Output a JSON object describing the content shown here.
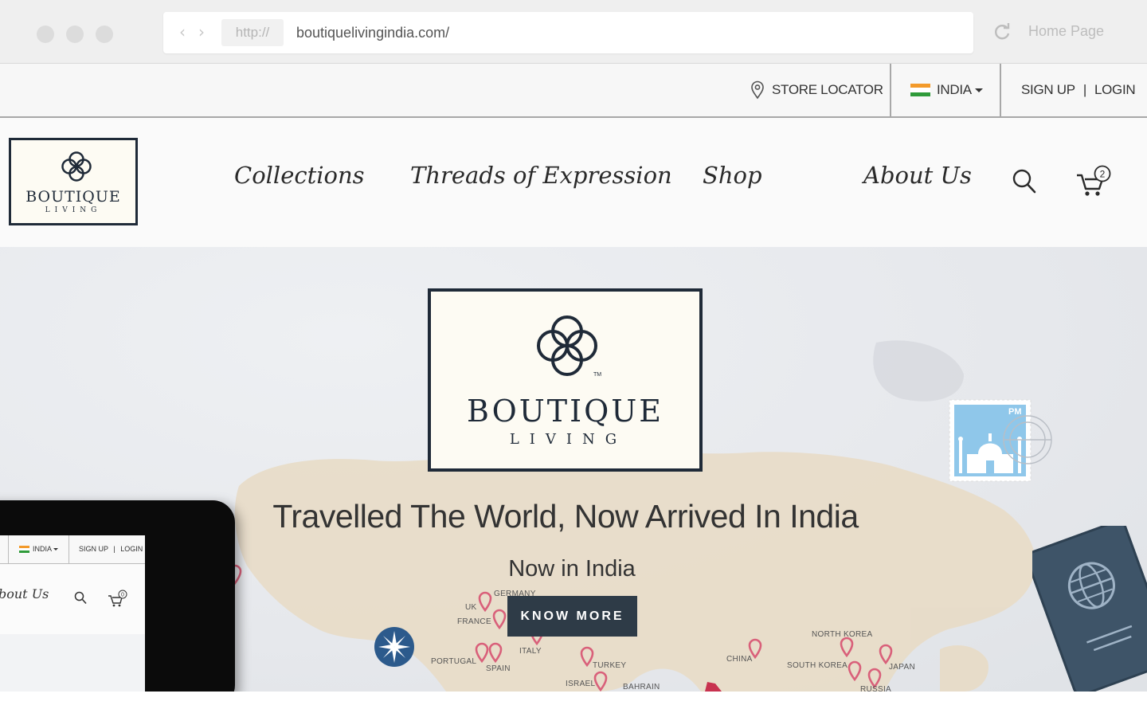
{
  "browser": {
    "protocol": "http://",
    "url": "boutiquelivingindia.com/",
    "home_label": "Home Page",
    "back_icon": "chevron-left-icon",
    "forward_icon": "chevron-right-icon",
    "reload_icon": "reload-icon"
  },
  "topbar": {
    "store_locator": "STORE LOCATOR",
    "country": "INDIA",
    "sign_up": "SIGN UP",
    "separator": "|",
    "login": "LOGIN"
  },
  "brand": {
    "name": "BOUTIQUE",
    "sub": "LIVING",
    "tm": "TM"
  },
  "nav": {
    "items": [
      {
        "label": "Collections"
      },
      {
        "label": "Threads of Expression"
      },
      {
        "label": "Shop"
      },
      {
        "label": "About Us"
      }
    ],
    "cart_count": "2"
  },
  "hero": {
    "headline": "Travelled The World, Now Arrived In India",
    "subline": "Now in India",
    "cta": "KNOW MORE",
    "stamp_text": "PM",
    "map_labels": [
      "GERMANY",
      "UK",
      "FRANCE",
      "PORTUGAL",
      "SPAIN",
      "ITALY",
      "TURKEY",
      "ISRAEL",
      "BAHRAIN",
      "CHINA",
      "NORTH KOREA",
      "SOUTH KOREA",
      "JAPAN",
      "RUSSIA"
    ]
  },
  "tablet": {
    "country": "INDIA",
    "sign_up": "SIGN UP",
    "separator": "|",
    "login": "LOGIN",
    "nav_partial": "bout Us",
    "cart_count": "0"
  },
  "colors": {
    "navy": "#1f2a38",
    "cta_bg": "#2e3b47",
    "pin": "#d9607a",
    "map_land": "#e8dcc6",
    "stamp_blue": "#8fc7ea",
    "passport": "#3e5468"
  }
}
